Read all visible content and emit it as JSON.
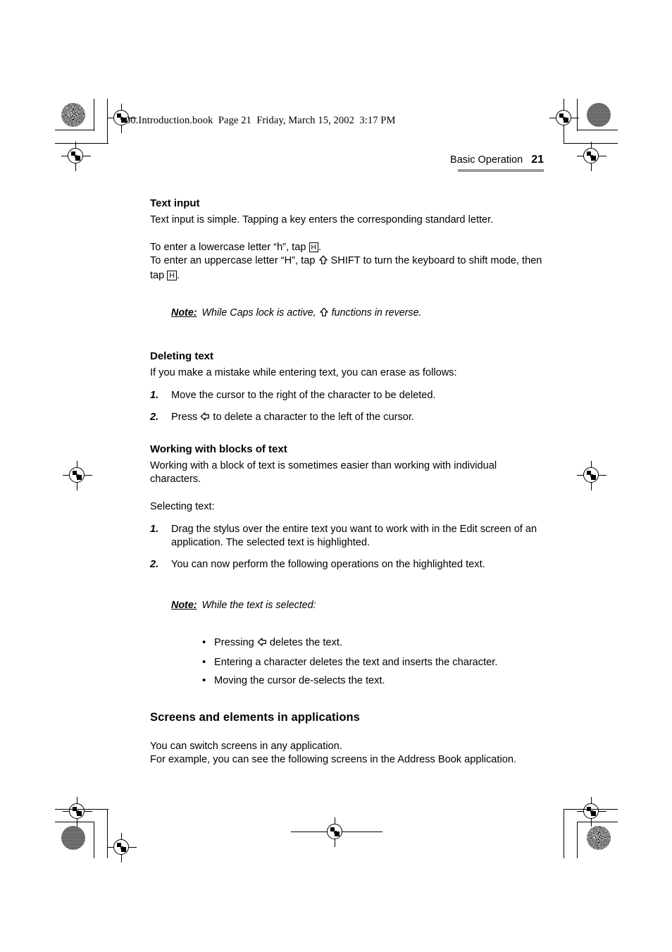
{
  "print_marks": {
    "registration_icon": "registration-target",
    "halftone_star_icon": "halftone-star-circle",
    "halftone_solid_icon": "halftone-solid-circle"
  },
  "file_stamp": "00.Introduction.book  Page 21  Friday, March 15, 2002  3:17 PM",
  "header": {
    "chapter": "Basic Operation",
    "page_number": "21",
    "rule_color": "#9a9a9a"
  },
  "glyphs": {
    "key_h": "H",
    "shift_arrow": "shift-key-up-arrow",
    "backspace_arrow": "backspace-key-left-arrow",
    "bullet": "•"
  },
  "sections": {
    "text_input": {
      "heading": "Text input",
      "intro": "Text input is simple. Tapping a key enters the corresponding standard letter.",
      "line_lower_a": "To enter a lowercase letter “h”, tap ",
      "line_lower_b": ".",
      "line_upper_a": "To enter an uppercase letter “H”, tap ",
      "line_upper_b": " SHIFT to turn the keyboard to shift mode, then tap ",
      "line_upper_c": ".",
      "note_label": "Note:",
      "note_a": "While Caps lock is active, ",
      "note_b": " functions in reverse."
    },
    "deleting_text": {
      "heading": "Deleting text",
      "intro": "If you make a mistake while entering text, you can erase as follows:",
      "steps": [
        {
          "num": "1.",
          "text": "Move the cursor to the right of the character to be deleted."
        },
        {
          "num": "2.",
          "pre": "Press ",
          "post": " to delete a character to the left of the cursor."
        }
      ]
    },
    "blocks_of_text": {
      "heading": "Working with blocks of text",
      "intro": "Working with a block of text is sometimes easier than working with individual characters.",
      "selecting_label": "Selecting text:",
      "steps": [
        {
          "num": "1.",
          "text": "Drag the stylus over the entire text you want to work with in the Edit screen of an application. The selected text is highlighted."
        },
        {
          "num": "2.",
          "text": "You can now perform the following operations on the highlighted text."
        }
      ],
      "note_label": "Note:",
      "note_text": "While the text is selected:",
      "bullets": [
        {
          "pre": "Pressing ",
          "post": " deletes the text."
        },
        {
          "text": "Entering a character deletes the text and inserts the character."
        },
        {
          "text": "Moving the cursor de-selects the text."
        }
      ]
    },
    "screens_elements": {
      "heading": "Screens and elements in applications",
      "line1": "You can switch screens in any application.",
      "line2": "For example, you can see the following screens in the Address Book application."
    }
  }
}
